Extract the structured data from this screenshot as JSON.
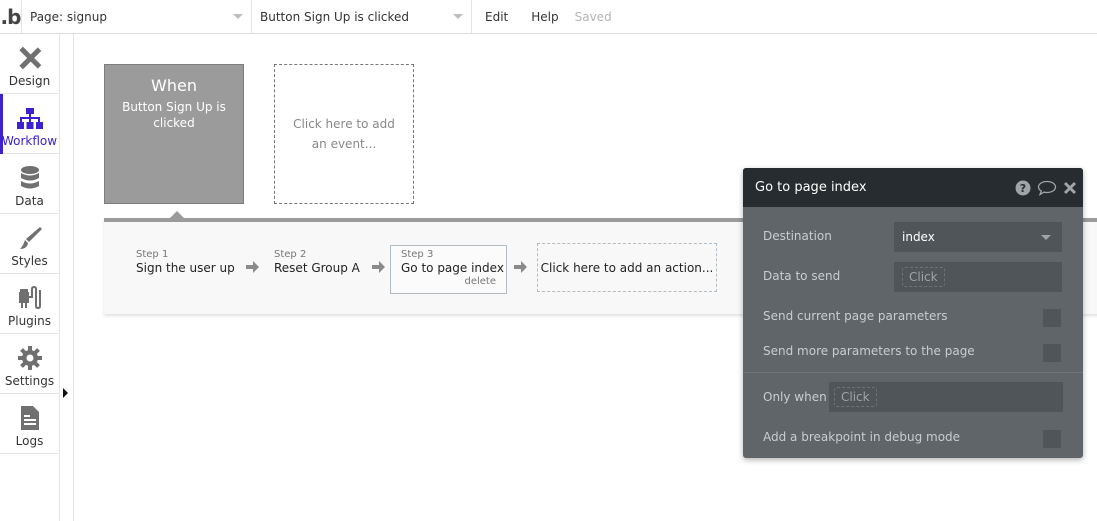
{
  "topbar": {
    "logo": ".b",
    "page_select": "Page: signup",
    "event_select": "Button Sign Up is clicked",
    "menu": [
      "Edit",
      "Help"
    ],
    "status": "Saved"
  },
  "sidebar": {
    "items": [
      {
        "label": "Design",
        "icon": "design-icon",
        "active": false
      },
      {
        "label": "Workflow",
        "icon": "workflow-icon",
        "active": true
      },
      {
        "label": "Data",
        "icon": "database-icon",
        "active": false
      },
      {
        "label": "Styles",
        "icon": "brush-icon",
        "active": false
      },
      {
        "label": "Plugins",
        "icon": "plug-icon",
        "active": false
      },
      {
        "label": "Settings",
        "icon": "gear-icon",
        "active": false
      },
      {
        "label": "Logs",
        "icon": "document-icon",
        "active": false
      }
    ],
    "active_color": "#3c21d1"
  },
  "workflow": {
    "event": {
      "title": "When",
      "description": "Button Sign Up is clicked"
    },
    "add_event": "Click here to add an event...",
    "steps": [
      {
        "num": "Step 1",
        "name": "Sign the user up"
      },
      {
        "num": "Step 2",
        "name": "Reset Group A"
      },
      {
        "num": "Step 3",
        "name": "Go to page index",
        "delete": "delete"
      }
    ],
    "add_action": "Click here to add an action..."
  },
  "property_editor": {
    "title": "Go to page index",
    "destination_label": "Destination",
    "destination_value": "index",
    "data_label": "Data to send",
    "data_placeholder": "Click",
    "send_current_label": "Send current page parameters",
    "send_current_checked": false,
    "send_more_label": "Send more parameters to the page",
    "send_more_checked": false,
    "only_when_label": "Only when",
    "only_when_placeholder": "Click",
    "breakpoint_label": "Add a breakpoint in debug mode",
    "breakpoint_checked": false
  }
}
